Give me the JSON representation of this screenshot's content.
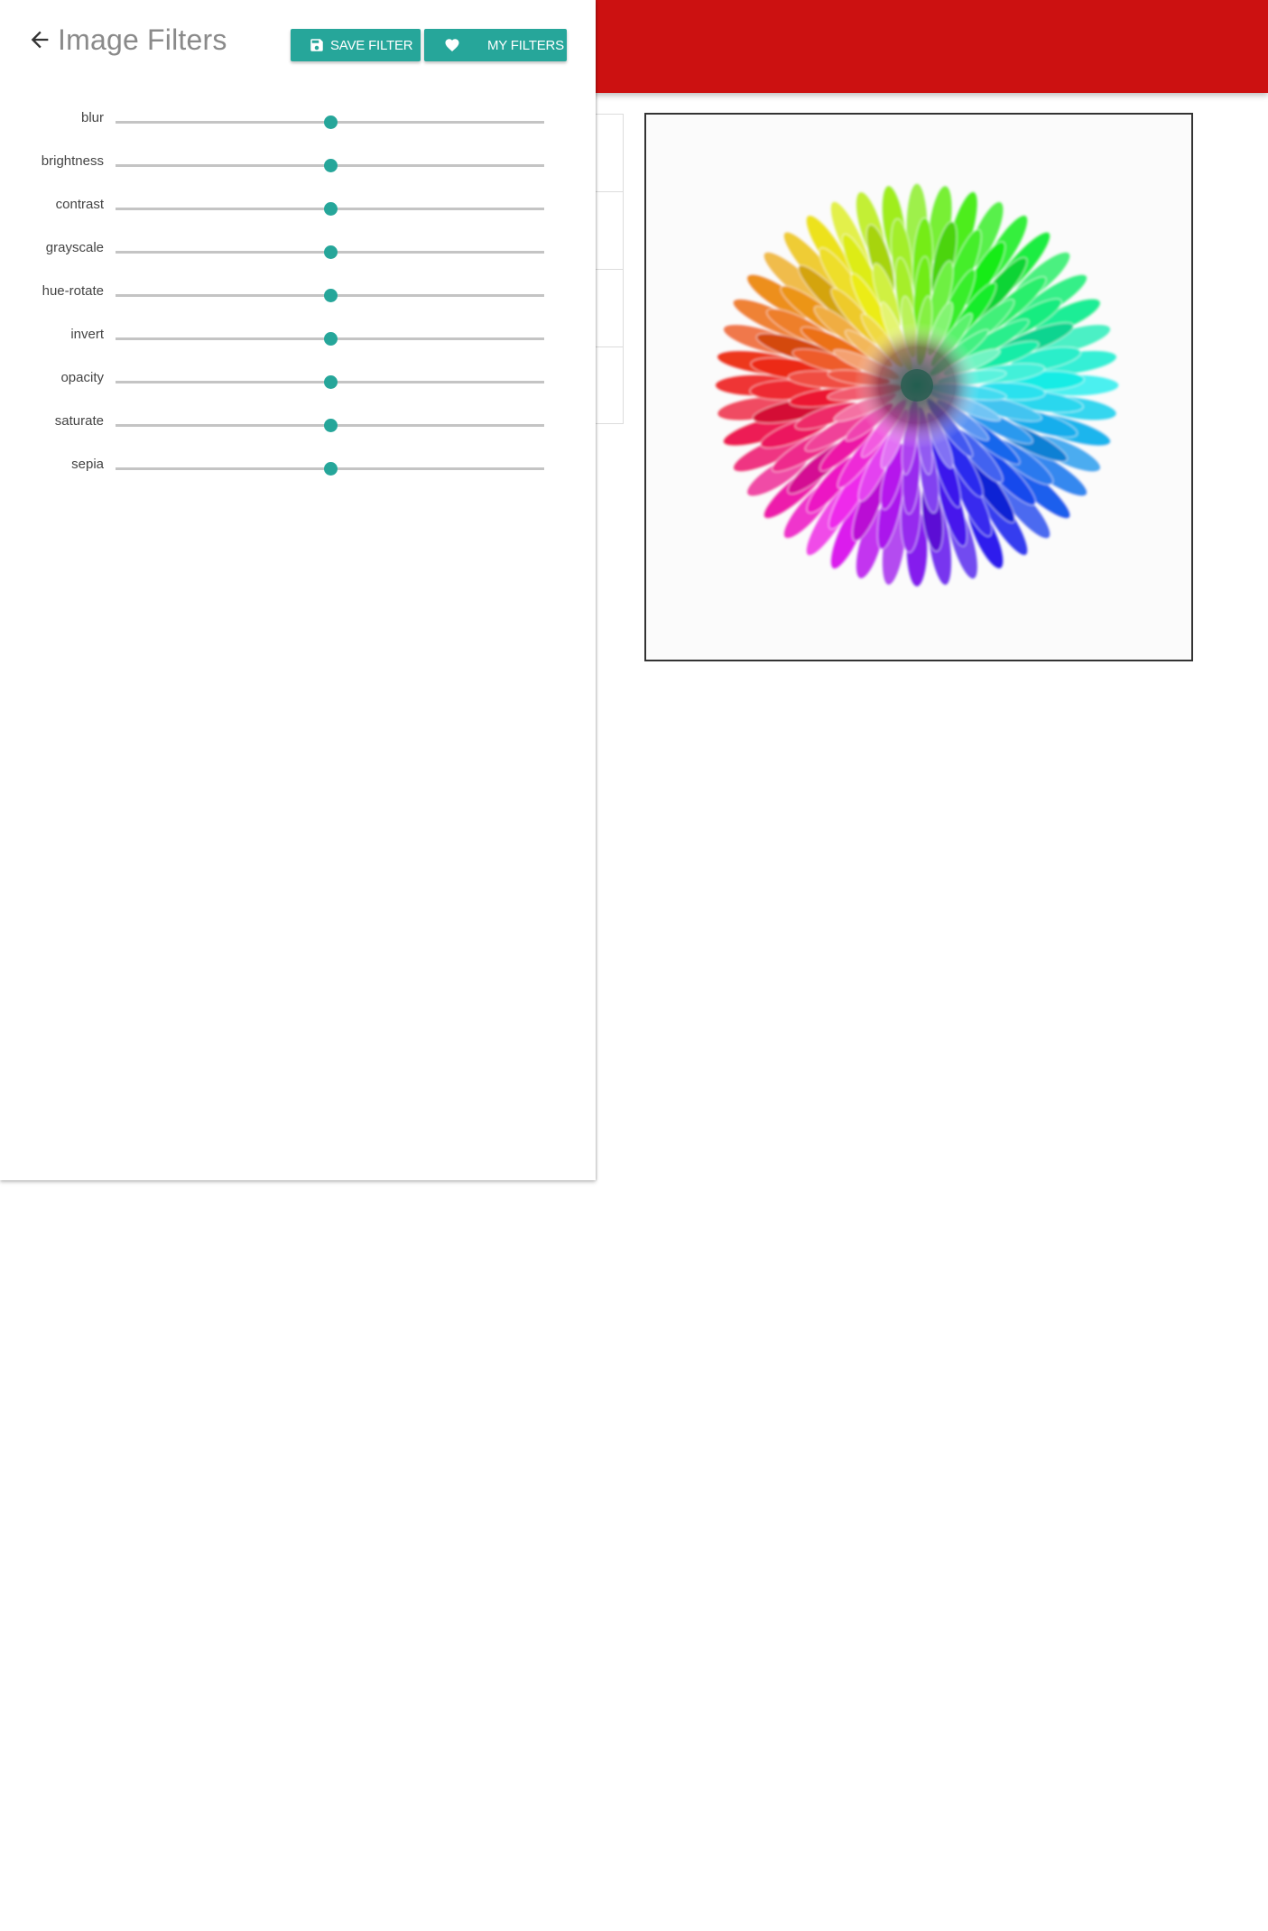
{
  "app": {
    "accent_color": "#26a69a",
    "topbar_color": "#cc1111"
  },
  "panel": {
    "back_icon": "arrow-left-icon",
    "title": "Image Filters",
    "buttons": {
      "save": {
        "label": "SAVE FILTER",
        "icon": "floppy-disk-icon"
      },
      "mine": {
        "label": "MY FILTERS",
        "icon": "heart-icon"
      }
    }
  },
  "filters": [
    {
      "label": "blur",
      "value": 0.5
    },
    {
      "label": "brightness",
      "value": 0.5
    },
    {
      "label": "contrast",
      "value": 0.5
    },
    {
      "label": "grayscale",
      "value": 0.5
    },
    {
      "label": "hue-rotate",
      "value": 0.5
    },
    {
      "label": "invert",
      "value": 0.5
    },
    {
      "label": "opacity",
      "value": 0.5
    },
    {
      "label": "saturate",
      "value": 0.5
    },
    {
      "label": "sepia",
      "value": 0.5
    }
  ],
  "preview": {
    "image": "rainbow-chrysanthemum-photo"
  }
}
